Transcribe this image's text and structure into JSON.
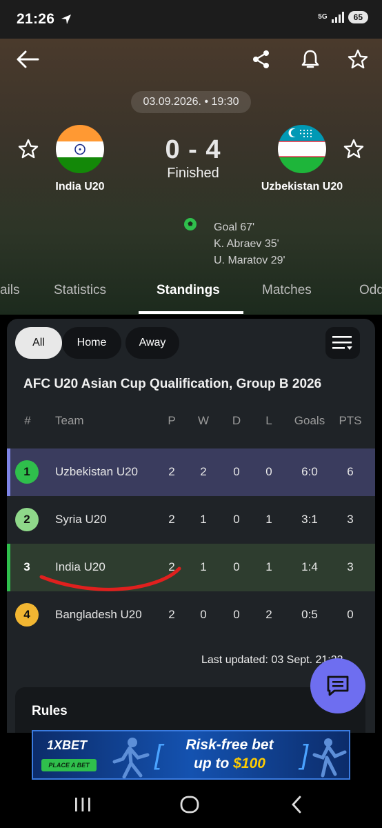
{
  "status_bar": {
    "time": "21:26",
    "network": "5G",
    "battery": "65"
  },
  "header": {
    "date_time": "03.09.2026. • 19:30",
    "home_team": {
      "name": "India U20",
      "flag_colors": [
        "#ff9933",
        "#ffffff",
        "#138808"
      ]
    },
    "away_team": {
      "name": "Uzbekistan U20",
      "flag_colors": [
        "#0099b5",
        "#ffffff",
        "#1eb53a"
      ]
    },
    "score": "0 - 4",
    "status": "Finished",
    "events": [
      "Goal 67'",
      "K. Abraev 35'",
      "U. Maratov 29'"
    ],
    "icons": [
      "back-arrow-icon",
      "share-icon",
      "bell-icon",
      "star-icon"
    ]
  },
  "tabs": [
    "ails",
    "Statistics",
    "Standings",
    "Matches",
    "Odd"
  ],
  "active_tab": "Standings",
  "filters": [
    "All",
    "Home",
    "Away"
  ],
  "active_filter": "All",
  "competition": "AFC U20 Asian Cup Qualification, Group B 2026",
  "columns": [
    "#",
    "Team",
    "P",
    "W",
    "D",
    "L",
    "Goals",
    "PTS"
  ],
  "rows": [
    {
      "pos": "1",
      "team": "Uzbekistan U20",
      "p": "2",
      "w": "2",
      "d": "0",
      "l": "0",
      "goals": "6:0",
      "pts": "6",
      "badge_color": "#2fbf4c"
    },
    {
      "pos": "2",
      "team": "Syria U20",
      "p": "2",
      "w": "1",
      "d": "0",
      "l": "1",
      "goals": "3:1",
      "pts": "3",
      "badge_color": "#8fd88a"
    },
    {
      "pos": "3",
      "team": "India U20",
      "p": "2",
      "w": "1",
      "d": "0",
      "l": "1",
      "goals": "1:4",
      "pts": "3",
      "badge_color": ""
    },
    {
      "pos": "4",
      "team": "Bangladesh U20",
      "p": "2",
      "w": "0",
      "d": "0",
      "l": "2",
      "goals": "0:5",
      "pts": "0",
      "badge_color": "#f2b632"
    }
  ],
  "last_updated": "Last updated: 03 Sept. 21:23",
  "rules_label": "Rules",
  "ad": {
    "brand": "1XBET",
    "cta": "PLACE A BET",
    "line1": "Risk-free bet",
    "line2_prefix": "up to ",
    "line2_amount": "$100"
  },
  "colors": {
    "accent_blue": "#7d84e6",
    "accent_green": "#2fbf4c",
    "fab": "#6e6ef0",
    "annotation_red": "#e0201e"
  }
}
